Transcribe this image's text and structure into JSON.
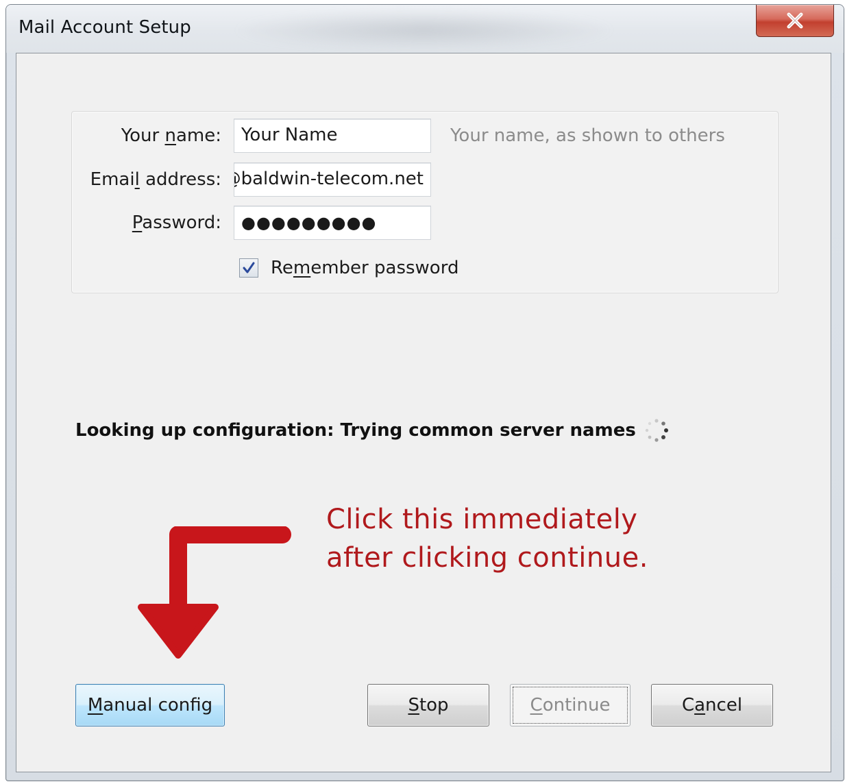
{
  "window": {
    "title": "Mail Account Setup",
    "close_label": "X"
  },
  "form": {
    "name": {
      "label_pre": "Your ",
      "label_accel": "n",
      "label_post": "ame:",
      "value": "Your Name",
      "hint": "Your name, as shown to others"
    },
    "email": {
      "label_pre": "Emai",
      "label_accel": "l",
      "label_post": " address:",
      "value": "@baldwin-telecom.net"
    },
    "password": {
      "label_pre": "",
      "label_accel": "P",
      "label_post": "assword:",
      "value": "●●●●●●●●●"
    },
    "remember": {
      "label_pre": "Re",
      "label_accel": "m",
      "label_post": "ember password",
      "checked": true
    }
  },
  "status": {
    "text": "Looking up configuration: Trying common server names"
  },
  "annotation": {
    "line1": "Click this immediately",
    "line2": "after clicking continue.",
    "color": "#b0191c"
  },
  "buttons": {
    "manual": {
      "accel": "M",
      "rest": "anual config"
    },
    "stop": {
      "accel": "S",
      "rest": "top"
    },
    "continue": {
      "accel": "C",
      "rest": "ontinue"
    },
    "cancel": {
      "pre": "C",
      "accel": "a",
      "rest": "ncel"
    }
  }
}
